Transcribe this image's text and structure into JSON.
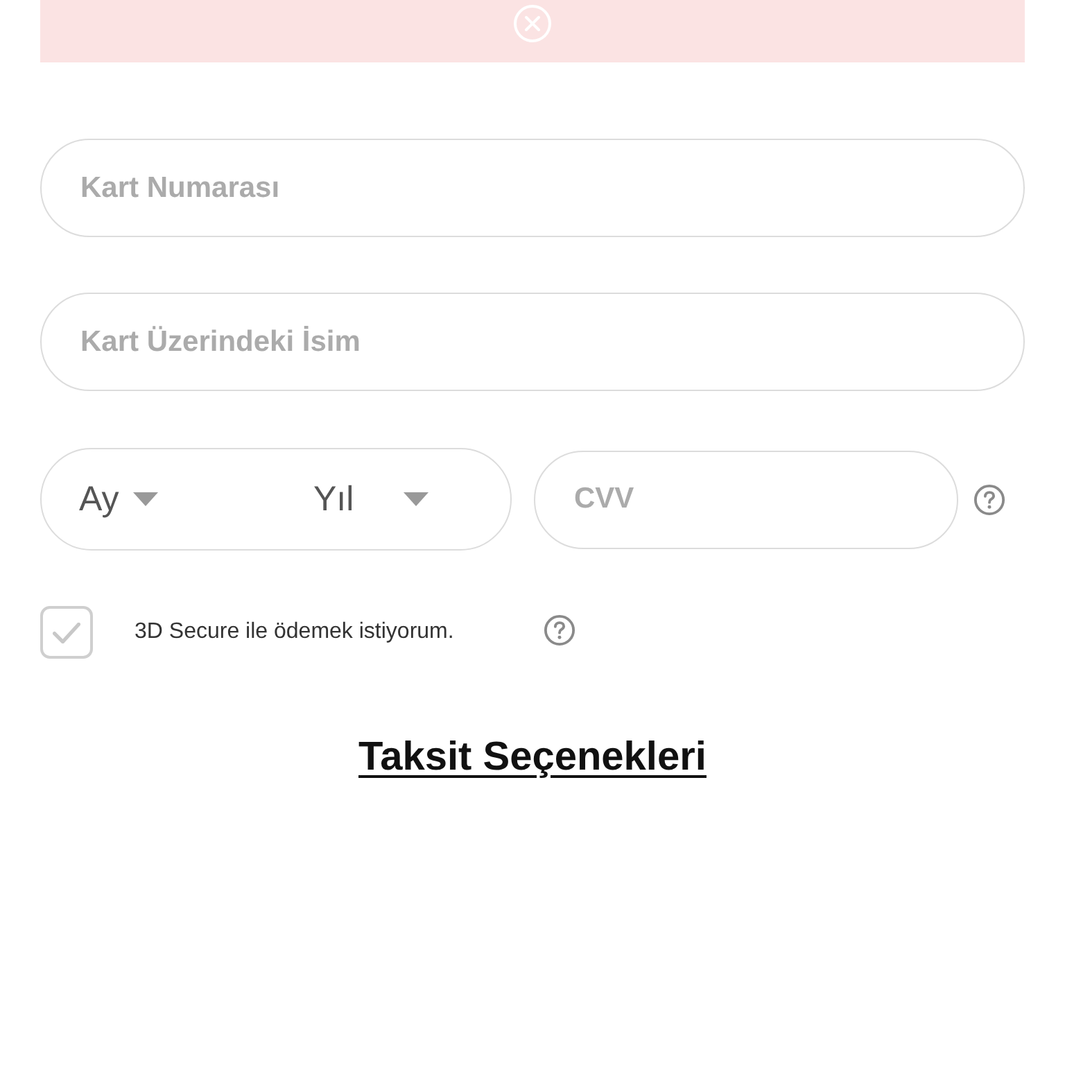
{
  "alert": {
    "dismissible": true
  },
  "fields": [
    {
      "kind": "text",
      "placeholder": "Kart Numarası"
    },
    {
      "kind": "text",
      "placeholder": "Kart Üzerindeki İsim"
    }
  ],
  "expiry": {
    "month": "Ay",
    "year": "Yıl"
  },
  "cvv": {
    "placeholder": "CVV",
    "help": true
  },
  "secure_3d": {
    "label": "3D Secure ile ödemek istiyorum.",
    "checked": false,
    "help": true
  },
  "installments_link": "Taksit Seçenekleri"
}
